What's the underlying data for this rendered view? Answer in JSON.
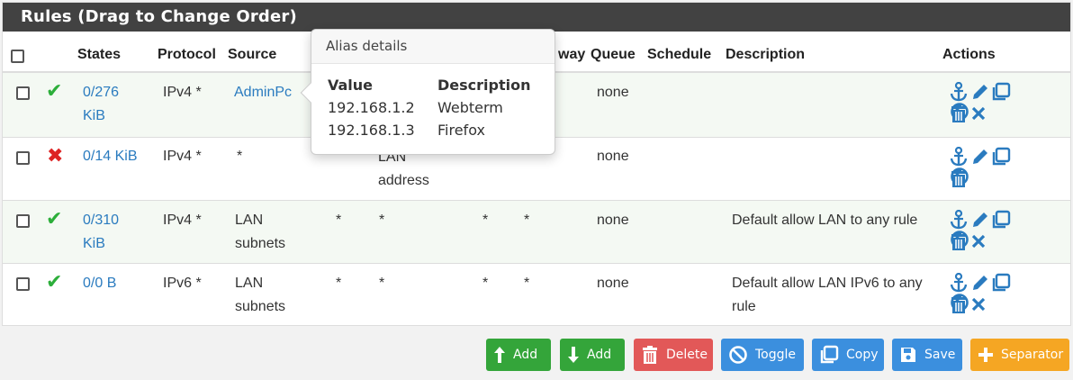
{
  "panel": {
    "title": "Rules (Drag to Change Order)"
  },
  "columns": {
    "states": "States",
    "protocol": "Protocol",
    "source": "Source",
    "gateway_partial": "way",
    "queue": "Queue",
    "schedule": "Schedule",
    "description": "Description",
    "actions": "Actions"
  },
  "rows": [
    {
      "status": "pass",
      "states": "0/276 KiB",
      "protocol": "IPv4 *",
      "source": "AdminPc",
      "port": "",
      "destination": "",
      "dport": "",
      "gateway": "",
      "queue": "none",
      "description": "",
      "extra_action": "block"
    },
    {
      "status": "block",
      "states": "0/14 KiB",
      "protocol": "IPv4 *",
      "source": "*",
      "port": "",
      "destination": "LAN address",
      "dport": "",
      "gateway": "",
      "queue": "none",
      "description": "",
      "extra_action": ""
    },
    {
      "status": "pass",
      "states": "0/310 KiB",
      "protocol": "IPv4 *",
      "source": "LAN subnets",
      "port": "*",
      "destination": "*",
      "dport": "*",
      "gateway": "*",
      "queue": "none",
      "description": "Default allow LAN to any rule",
      "extra_action": "block"
    },
    {
      "status": "pass",
      "states": "0/0 B",
      "protocol": "IPv6 *",
      "source": "LAN subnets",
      "port": "*",
      "destination": "*",
      "dport": "*",
      "gateway": "*",
      "queue": "none",
      "description": "Default allow LAN IPv6 to any rule",
      "extra_action": "block"
    }
  ],
  "popover": {
    "title": "Alias details",
    "col_value": "Value",
    "col_description": "Description",
    "entries": [
      {
        "value": "192.168.1.2",
        "description": "Webterm"
      },
      {
        "value": "192.168.1.3",
        "description": "Firefox"
      }
    ]
  },
  "buttons": {
    "add_top": "Add",
    "add_bottom": "Add",
    "delete": "Delete",
    "toggle": "Toggle",
    "copy": "Copy",
    "save": "Save",
    "separator": "Separator"
  },
  "colors": {
    "pass": "#2cae3a",
    "block": "#dd2222",
    "link": "#2a7bbf",
    "success": "#34a53a",
    "danger": "#e25858",
    "info": "#3b8fde",
    "warning": "#f5a623"
  },
  "icons": {
    "pass": "check-icon",
    "block": "x-icon",
    "actions": [
      "anchor-icon",
      "pencil-icon",
      "copy-icon",
      "disable-icon",
      "trash-icon",
      "delete-x-icon"
    ]
  }
}
